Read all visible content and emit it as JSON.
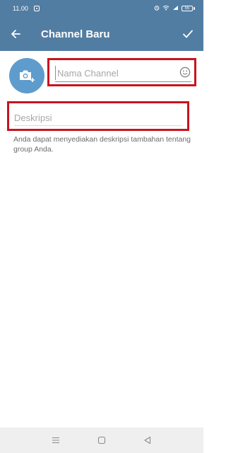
{
  "status_bar": {
    "time": "11.00",
    "battery": "55",
    "icons": [
      "notification-icon",
      "alarm-icon",
      "wifi-icon",
      "signal-icon",
      "battery-icon"
    ]
  },
  "header": {
    "title": "Channel Baru",
    "back_icon": "arrow-left-icon",
    "done_icon": "check-icon"
  },
  "form": {
    "avatar_icon": "camera-add-icon",
    "name": {
      "placeholder": "Nama Channel",
      "value": ""
    },
    "emoji_icon": "smiley-icon",
    "description": {
      "placeholder": "Deskripsi",
      "value": ""
    },
    "help_text": "Anda dapat menyediakan deskripsi tambahan tentang group Anda."
  },
  "nav_bar": {
    "icons": [
      "menu-icon",
      "home-icon",
      "back-triangle-icon"
    ]
  },
  "colors": {
    "header_bg": "#527da3",
    "accent": "#5e9ccd",
    "highlight_border": "#c8141e"
  }
}
